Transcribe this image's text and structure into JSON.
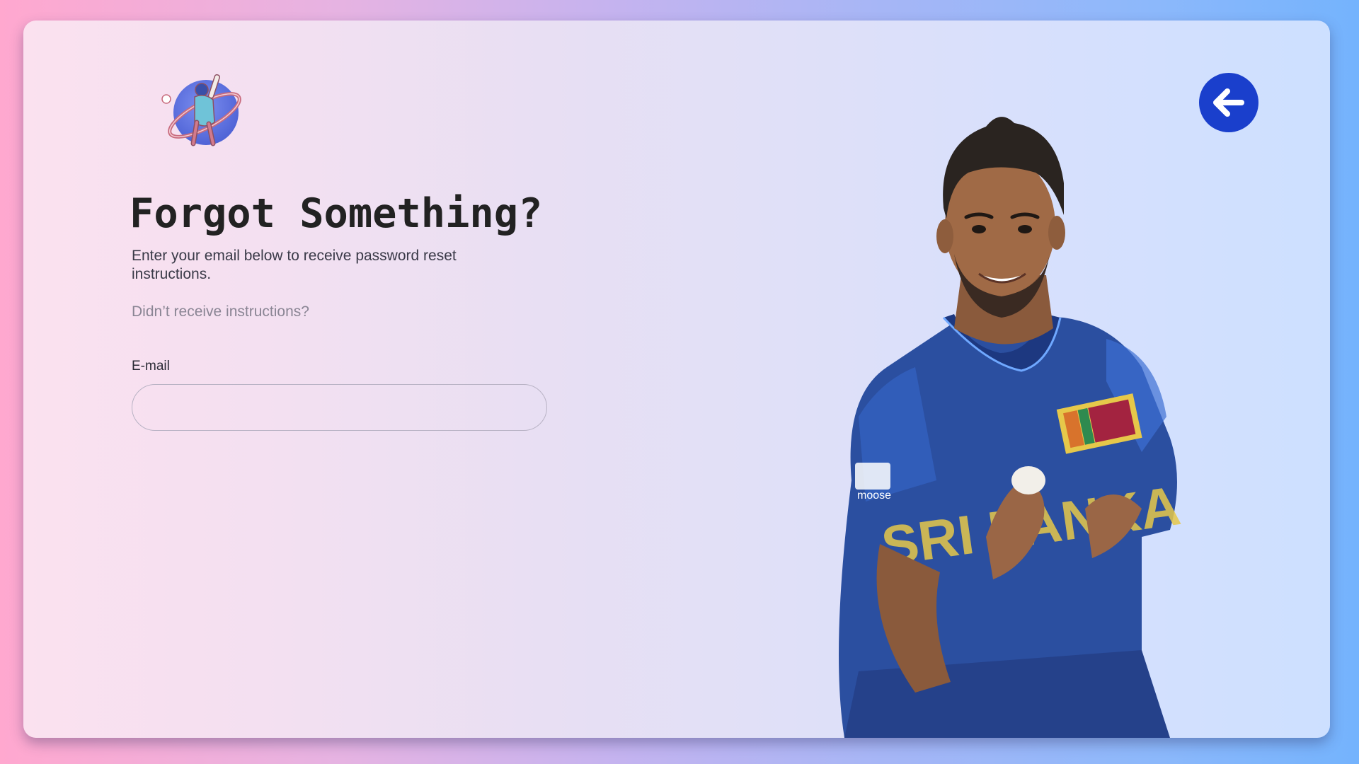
{
  "page": {
    "title": "Forgot Something?",
    "subtitle": "Enter your email below to receive password reset instructions.",
    "resend_link": "Didn’t receive instructions?"
  },
  "form": {
    "email_label": "E-mail",
    "email_value": "",
    "email_placeholder": ""
  },
  "header": {
    "logo_icon": "cricket-batsman-logo-icon",
    "back_icon": "arrow-left-icon"
  },
  "hero": {
    "image": "cricket-player-portrait",
    "jersey_text": "SRI LANKA",
    "jersey_sponsor": "moose"
  },
  "colors": {
    "back_button": "#1a3fcc",
    "jersey": "#2b4fa0",
    "jersey_lettering": "#e6c84a"
  }
}
